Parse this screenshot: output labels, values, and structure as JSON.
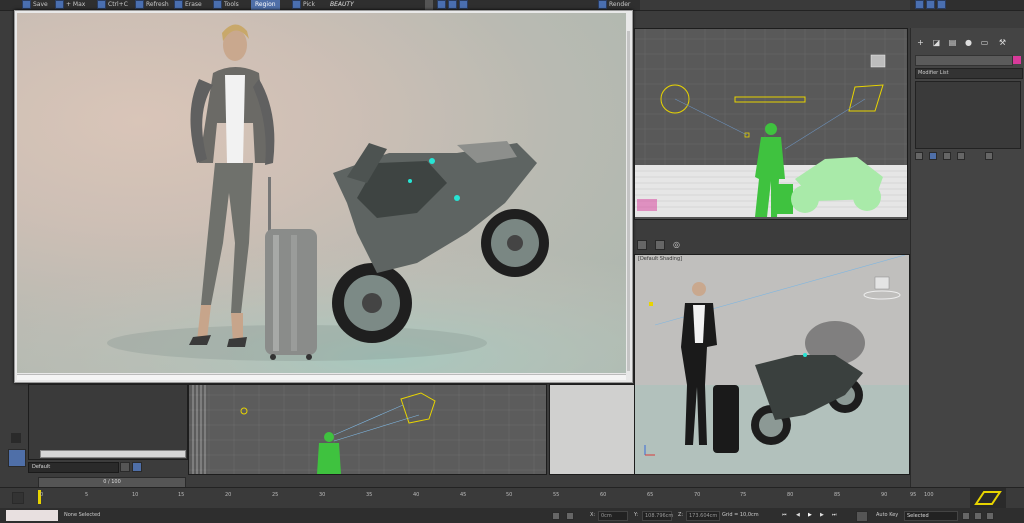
{
  "toolbar": {
    "save": "Save",
    "max": "+ Max",
    "ctrl_c": "Ctrl+C",
    "refresh": "Refresh",
    "erase": "Erase",
    "tools": "Tools",
    "region": "Region",
    "pick": "Pick",
    "beauty": "BEAUTY",
    "render": "Render"
  },
  "viewports": {
    "perspective_label": "[Default Shading]"
  },
  "command_panel": {
    "modifier_list": "Modifier List"
  },
  "timeline": {
    "frame_counter": "0 / 100",
    "ticks": [
      "0",
      "5",
      "10",
      "15",
      "20",
      "25",
      "30",
      "35",
      "40",
      "45",
      "50",
      "55",
      "60",
      "65",
      "70",
      "75",
      "80",
      "85",
      "90",
      "95",
      "100"
    ]
  },
  "layer": {
    "default": "Default"
  },
  "status": {
    "selection": "None Selected",
    "x_label": "X:",
    "y_label": "Y:",
    "z_label": "Z:",
    "x_val": "0cm",
    "y_val": "108.796cm",
    "z_val": "173.604cm",
    "grid": "Grid = 10,0cm",
    "auto_key": "Auto Key",
    "selected": "Selected"
  },
  "colors": {
    "accent": "#4f6fa8",
    "highlight_green": "#3fc23f",
    "magenta_swatch": "#d83a9a",
    "spline_yellow": "#e8d400"
  }
}
